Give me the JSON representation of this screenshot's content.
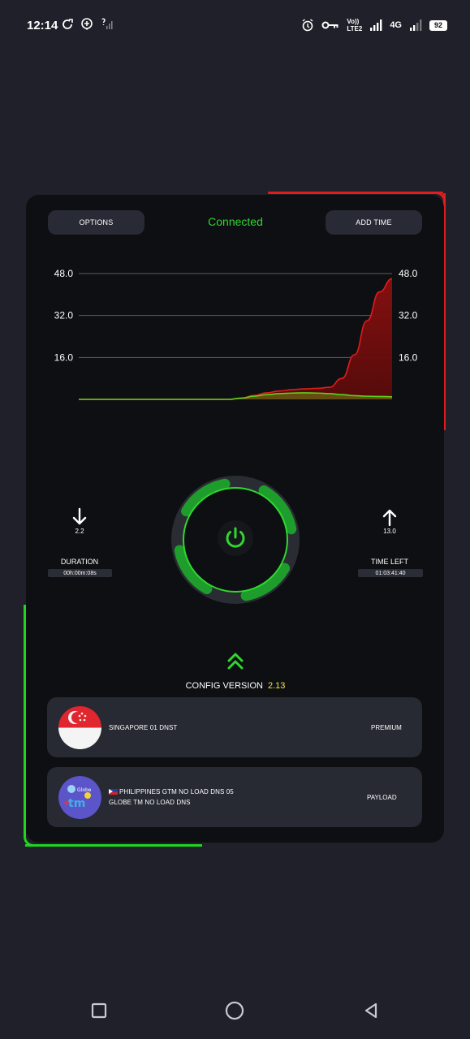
{
  "status_bar": {
    "time": "12:14",
    "left_icons": [
      "sync-icon",
      "add-location-icon",
      "no-signal-icon"
    ],
    "right_icons": [
      "alarm-icon",
      "vpn-key-icon",
      "volte-indicator",
      "signal-icon",
      "network-type",
      "signal-2-icon",
      "battery"
    ],
    "volte_line1": "Vo)) ",
    "volte_line2": "LTE2",
    "network_type": "4G",
    "battery": "92"
  },
  "header": {
    "options_label": "OPTIONS",
    "status": "Connected",
    "add_time_label": "ADD TIME"
  },
  "chart_data": {
    "type": "area",
    "ylim": [
      0,
      48
    ],
    "yticks_left": [
      "48.0",
      "32.0",
      "16.0"
    ],
    "yticks_right": [
      "48.0",
      "32.0",
      "16.0"
    ],
    "grid": true,
    "series": [
      {
        "color": "#e01d1d",
        "values": [
          0,
          0,
          0,
          0,
          0,
          0,
          0,
          0,
          0,
          0,
          0,
          0,
          0,
          0.5,
          1.5,
          2.5,
          3.2,
          3.7,
          4.0,
          4.2,
          4.6,
          8,
          17,
          30,
          41,
          46
        ]
      },
      {
        "color": "#5dd11d",
        "values": [
          0,
          0,
          0,
          0,
          0,
          0,
          0,
          0,
          0,
          0,
          0,
          0,
          0,
          0.5,
          1.2,
          1.8,
          2.2,
          2.4,
          2.5,
          2.4,
          2.2,
          1.8,
          1.4,
          1.2,
          1.1,
          1.0
        ]
      }
    ]
  },
  "download": {
    "value": "2.2",
    "label": "DURATION",
    "box": "00h:00m:08s"
  },
  "upload": {
    "value": "13.0",
    "label": "TIME LEFT",
    "box": "01:03:41:40"
  },
  "config": {
    "label": "CONFIG VERSION",
    "version": "2.13"
  },
  "servers": [
    {
      "name": "SINGAPORE 01  DNST",
      "tag": "PREMIUM"
    },
    {
      "name_line1": "PHILIPPINES GTM NO LOAD DNS 05",
      "name_line2": "GLOBE TM NO LOAD DNS",
      "tag": "PAYLOAD"
    }
  ],
  "colors": {
    "accent_green": "#1fd61f",
    "accent_red": "#e01d1d",
    "config_version": "#f1e44a",
    "card_bg": "#0e0f12",
    "page_bg": "#1f2029"
  }
}
